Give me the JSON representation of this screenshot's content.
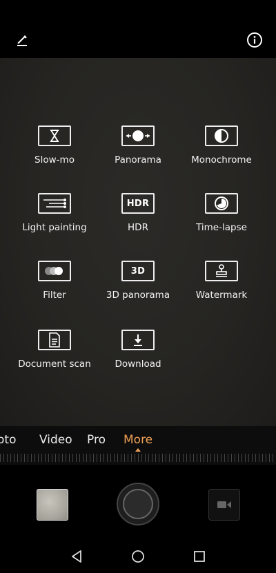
{
  "top_bar": {
    "edit_icon": "pencil-edit-icon",
    "info_icon": "info-circle-icon"
  },
  "modes": [
    {
      "label": "Slow-mo",
      "icon": "hourglass-icon"
    },
    {
      "label": "Panorama",
      "icon": "panorama-icon"
    },
    {
      "label": "Monochrome",
      "icon": "half-circle-icon"
    },
    {
      "label": "Light painting",
      "icon": "light-streak-icon"
    },
    {
      "label": "HDR",
      "icon": "hdr-icon",
      "box_text": "HDR"
    },
    {
      "label": "Time-lapse",
      "icon": "time-lapse-icon"
    },
    {
      "label": "Filter",
      "icon": "filter-dots-icon"
    },
    {
      "label": "3D panorama",
      "icon": "3d-icon",
      "box_text": "3D"
    },
    {
      "label": "Watermark",
      "icon": "stamp-icon"
    },
    {
      "label": "Document scan",
      "icon": "document-icon"
    },
    {
      "label": "Download",
      "icon": "download-icon"
    }
  ],
  "mode_strip": {
    "tabs": [
      "oto",
      "Video",
      "Pro",
      "More"
    ],
    "active": "More"
  },
  "controls": {
    "gallery_icon": "gallery-thumbnail",
    "shutter_icon": "shutter-button",
    "video_icon": "video-camera-icon"
  },
  "navbar": {
    "back": "back-triangle-icon",
    "home": "home-circle-icon",
    "recents": "recents-square-icon"
  },
  "colors": {
    "accent": "#f0a055",
    "background": "#262522"
  }
}
